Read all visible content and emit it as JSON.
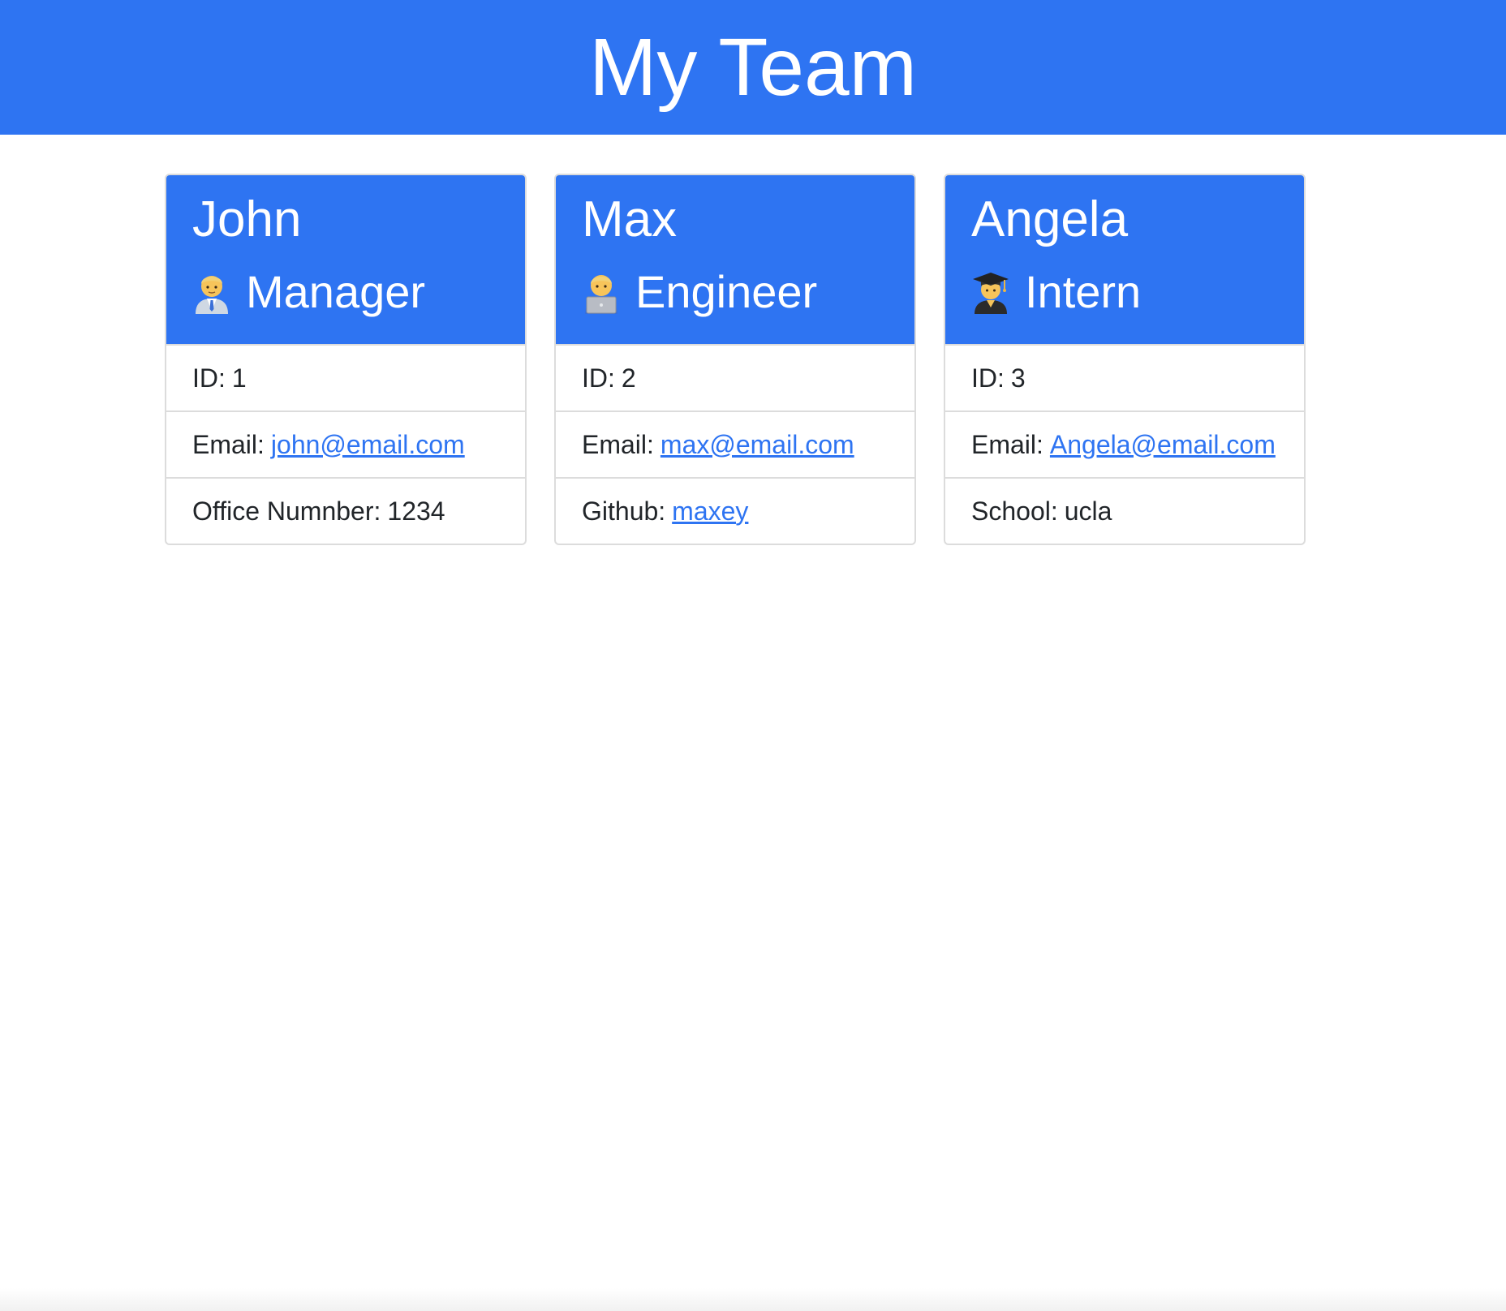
{
  "header": {
    "title": "My Team"
  },
  "colors": {
    "accent": "#2e74f2",
    "link": "#2e74f2",
    "border": "#dcdcdc"
  },
  "cards": [
    {
      "name": "John",
      "role": "Manager",
      "role_icon": "manager-icon",
      "id_label": "ID:",
      "id_value": "1",
      "email_label": "Email:",
      "email_value": "john@email.com",
      "extra_label": "Office Numnber:",
      "extra_value": "1234"
    },
    {
      "name": "Max",
      "role": "Engineer",
      "role_icon": "engineer-icon",
      "id_label": "ID:",
      "id_value": "2",
      "email_label": "Email:",
      "email_value": "max@email.com",
      "extra_label": "Github:",
      "extra_value": "maxey"
    },
    {
      "name": "Angela",
      "role": "Intern",
      "role_icon": "graduate-icon",
      "id_label": "ID:",
      "id_value": "3",
      "email_label": "Email:",
      "email_value": "Angela@email.com",
      "extra_label": "School:",
      "extra_value": "ucla"
    }
  ]
}
